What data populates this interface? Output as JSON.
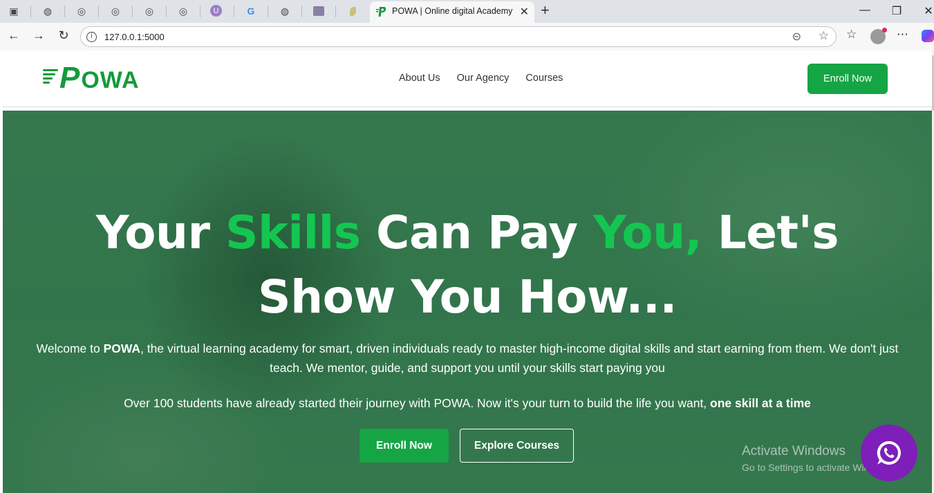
{
  "browser": {
    "active_tab": {
      "title": "POWA | Online digital Academy",
      "favicon": "powa-p-icon"
    },
    "inactive_tabs": [
      {
        "icon": "github-icon"
      },
      {
        "icon": "globe-icon"
      },
      {
        "icon": "globe-icon"
      },
      {
        "icon": "globe-icon"
      },
      {
        "icon": "globe-icon"
      },
      {
        "icon": "purple-u-icon"
      },
      {
        "icon": "google-icon"
      },
      {
        "icon": "github-icon"
      },
      {
        "icon": "site-thumbnail-icon"
      },
      {
        "icon": "leaf-icon"
      }
    ],
    "url": "127.0.0.1:5000",
    "glyphs": {
      "sidebar": "▣",
      "github": "◍",
      "globe": "◎",
      "u": "U",
      "google": "G",
      "close": "✕",
      "new_tab": "+",
      "minimize": "—",
      "restore": "❐",
      "back": "←",
      "forward": "→",
      "reload": "↻",
      "info": "i",
      "read": "⊝",
      "star": "☆",
      "favorites": "☆",
      "more": "⋯"
    }
  },
  "site": {
    "logo": {
      "letter": "P",
      "rest": "OWA"
    },
    "nav": {
      "links": [
        "About Us",
        "Our Agency",
        "Courses"
      ],
      "enroll": "Enroll Now"
    },
    "hero": {
      "title_parts": [
        "Your ",
        "Skills",
        " Can Pay ",
        "You,",
        " Let's Show You How..."
      ],
      "intro_pre": "Welcome to ",
      "intro_brand": "POWA",
      "intro_post": ", the virtual learning academy for smart, driven individuals ready to master high-income digital skills and start earning from them. We don't just teach. We mentor, guide, and support you until your skills start paying you",
      "journey_pre": "Over 100 students have already started their journey with POWA. Now it's your turn to build the life you want, ",
      "journey_bold": "one skill at a time",
      "buttons": {
        "enroll": "Enroll Now",
        "explore": "Explore Courses"
      }
    },
    "whatsapp": {
      "icon": "whatsapp-icon"
    }
  },
  "os_watermark": {
    "line1": "Activate Windows",
    "line2": "Go to Settings to activate Windows."
  },
  "colors": {
    "brand_green": "#15a545",
    "accent_green": "#14c651",
    "whatsapp_purple": "#7d1fb8"
  }
}
